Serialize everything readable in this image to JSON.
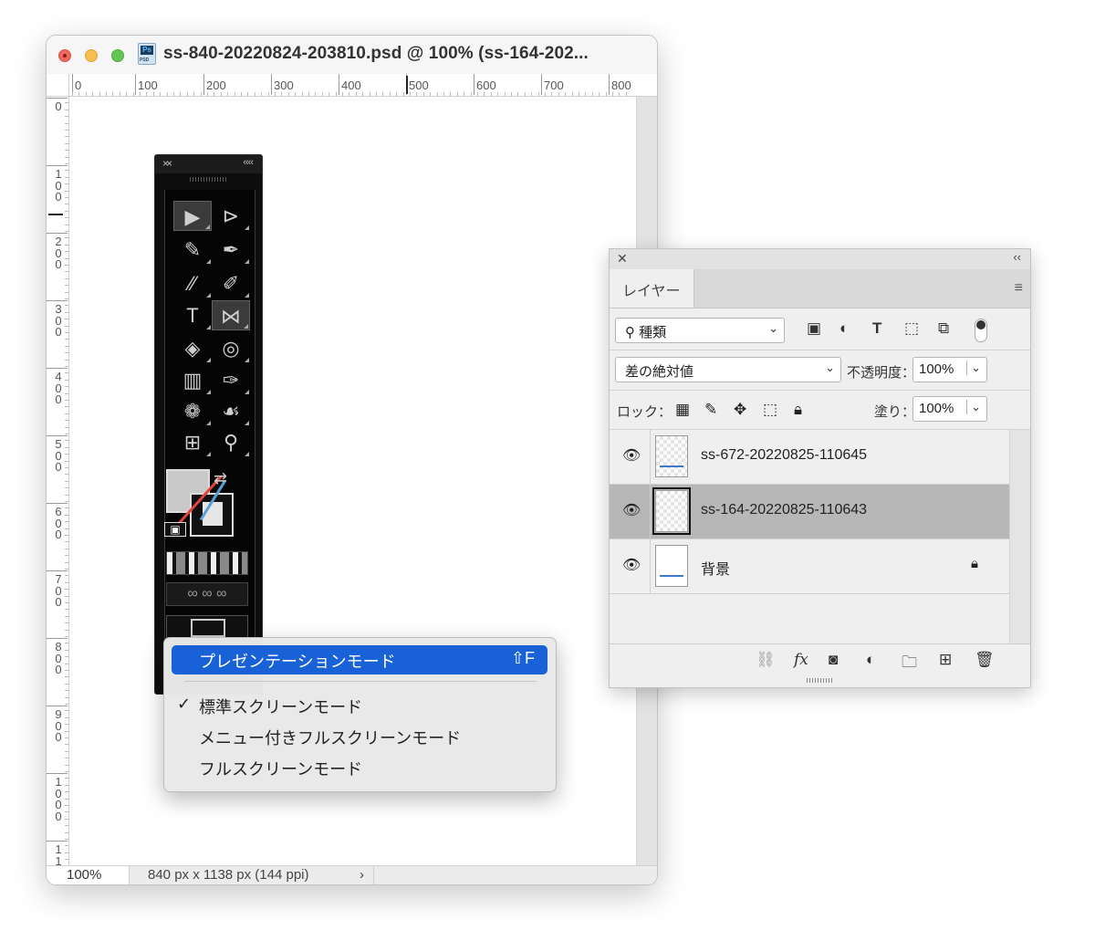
{
  "window": {
    "title": "ss-840-20220824-203810.psd @ 100% (ss-164-202...",
    "file_icon_label": "Ps",
    "file_icon_ext": "PSD"
  },
  "ruler": {
    "top_labels": [
      "0",
      "100",
      "200",
      "300",
      "400",
      "500",
      "600",
      "700",
      "800"
    ],
    "left_labels": [
      "0",
      "100",
      "200",
      "300",
      "400",
      "500",
      "600",
      "700",
      "800",
      "900",
      "1000",
      "11"
    ]
  },
  "status": {
    "zoom": "100%",
    "dimensions": "840 px x 1138 px (144 ppi)",
    "arrow": "›"
  },
  "tools_panel": {
    "close_glyph": "××",
    "collapse_glyph": "‹‹‹‹"
  },
  "menu": {
    "items": [
      {
        "label": "プレゼンテーションモード",
        "shortcut": "⇧F",
        "highlighted": true,
        "checked": false
      },
      {
        "label": "標準スクリーンモード",
        "checked": true
      },
      {
        "label": "メニュー付きフルスクリーンモード",
        "checked": false
      },
      {
        "label": "フルスクリーンモード",
        "checked": false
      }
    ],
    "check_glyph": "✓"
  },
  "layers_panel": {
    "close_glyph": "✕",
    "collapse_glyph": "‹‹",
    "tab_label": "レイヤー",
    "menu_glyph": "≡",
    "filter_dropdown": "種類",
    "blend_mode": "差の絶対値",
    "opacity_label": "不透明度：",
    "opacity_value": "100%",
    "lock_label": "ロック：",
    "fill_label": "塗り：",
    "fill_value": "100%",
    "layers": [
      {
        "name": "ss-672-20220825-110645",
        "selected": false,
        "locked": false
      },
      {
        "name": "ss-164-20220825-110643",
        "selected": true,
        "locked": false
      },
      {
        "name": "背景",
        "selected": false,
        "locked": true
      }
    ],
    "footer_icons": [
      "link-icon",
      "fx-icon",
      "mask-icon",
      "adjustment-icon",
      "folder-icon",
      "new-layer-icon",
      "trash-icon"
    ]
  },
  "colors": {
    "accent": "#1961d7",
    "selected_row": "#b7b7b7",
    "traffic_red": "#ed6a5e",
    "traffic_yellow": "#f5bf4f",
    "traffic_green": "#62c554"
  }
}
